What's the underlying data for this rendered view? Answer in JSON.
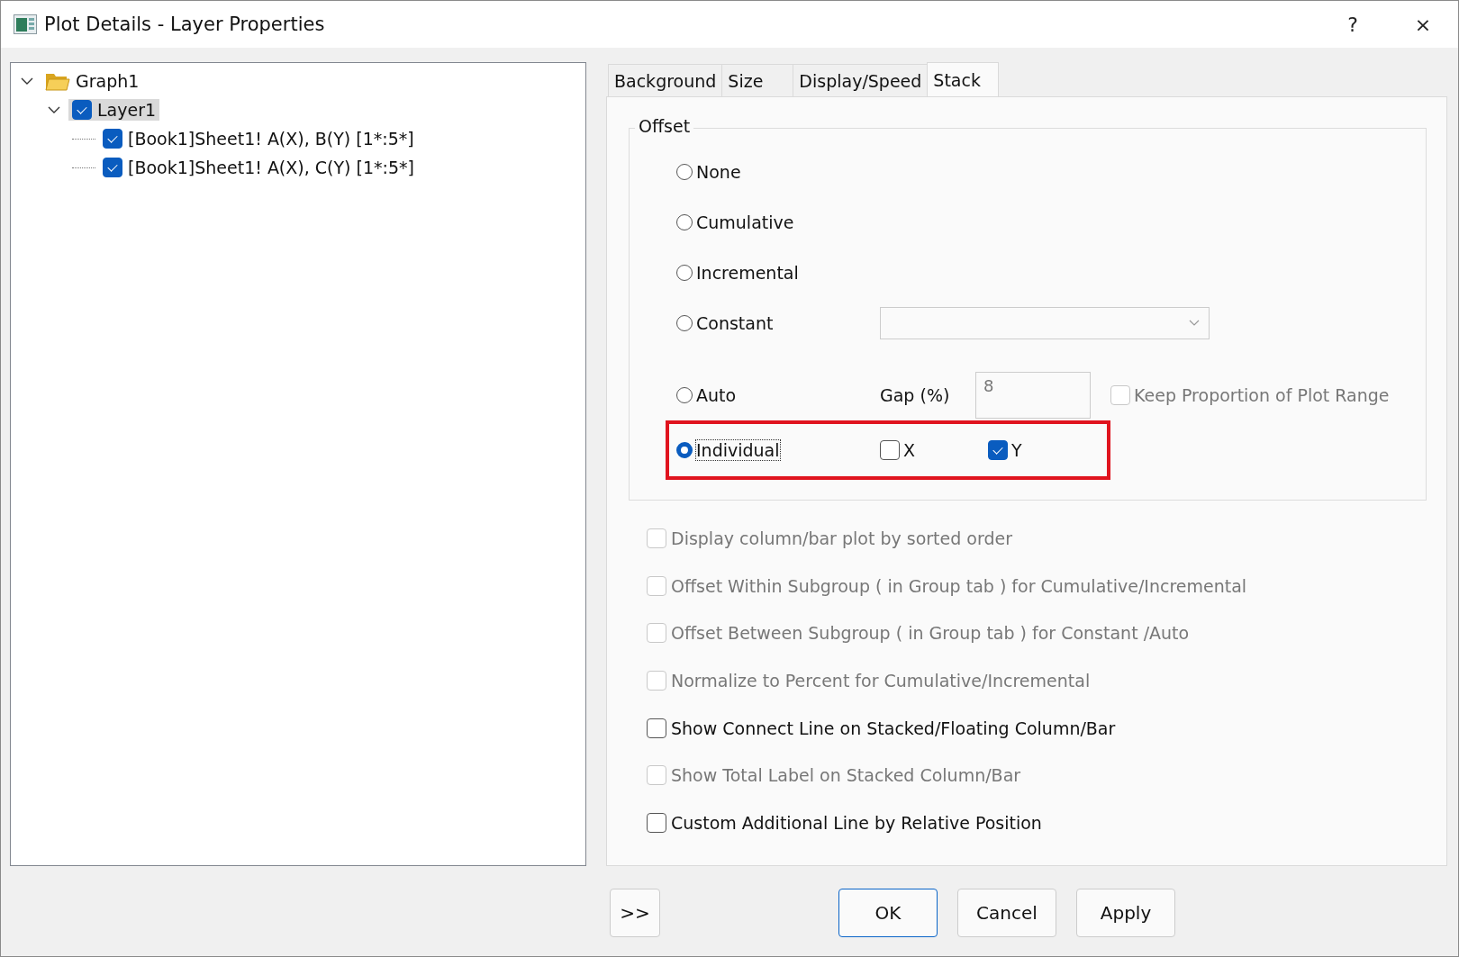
{
  "window": {
    "title": "Plot Details - Layer Properties",
    "buttons": [
      "?",
      "×"
    ]
  },
  "tree": [
    {
      "label": "Graph1",
      "kind": "folder",
      "expanded": true,
      "selected": false,
      "children": [
        {
          "label": "Layer1",
          "kind": "checkbox",
          "checked": true,
          "expanded": true,
          "selected": true,
          "children": [
            {
              "label": "[Book1]Sheet1! A(X), B(Y) [1*:5*]",
              "kind": "checkbox",
              "checked": true,
              "selected": false
            },
            {
              "label": "[Book1]Sheet1! A(X), C(Y) [1*:5*]",
              "kind": "checkbox",
              "checked": true,
              "selected": false
            }
          ]
        }
      ]
    }
  ],
  "tabs": [
    {
      "label": "Background",
      "selected": false
    },
    {
      "label": "Size",
      "selected": false
    },
    {
      "label": "Display/Speed",
      "selected": false
    },
    {
      "label": "Stack",
      "selected": true
    }
  ],
  "offset": {
    "title": "Offset",
    "options": [
      {
        "label": "None",
        "selected": false,
        "highlighted": false
      },
      {
        "label": "Cumulative",
        "selected": false,
        "highlighted": false
      },
      {
        "label": "Incremental",
        "selected": false,
        "highlighted": false
      },
      {
        "label": "Constant",
        "selected": false,
        "highlighted": false,
        "extras": [
          {
            "kind": "dropdown"
          }
        ]
      },
      {
        "label": "Auto",
        "selected": false,
        "highlighted": false,
        "extras": [
          {
            "kind": "label",
            "text": "Gap (%)"
          },
          {
            "kind": "field",
            "value": "8"
          },
          {
            "kind": "checkbox",
            "label": "Keep Proportion of Plot Range",
            "checked": false,
            "disabled": true
          }
        ]
      },
      {
        "label": "Individual",
        "selected": true,
        "highlighted": true,
        "extras": [
          {
            "kind": "checkbox",
            "label": "X",
            "checked": false,
            "disabled": false
          },
          {
            "kind": "checkbox",
            "label": "Y",
            "checked": true,
            "disabled": false
          }
        ]
      }
    ]
  },
  "options": [
    {
      "label": "Display column/bar plot by sorted order",
      "checked": false,
      "disabled": true
    },
    {
      "label": "Offset Within Subgroup ( in Group tab ) for Cumulative/Incremental",
      "checked": false,
      "disabled": true
    },
    {
      "label": "Offset Between Subgroup ( in Group tab ) for Constant /Auto",
      "checked": false,
      "disabled": true
    },
    {
      "label": "Normalize to Percent for Cumulative/Incremental",
      "checked": false,
      "disabled": true
    },
    {
      "label": "Show Connect Line on Stacked/Floating Column/Bar",
      "checked": false,
      "disabled": false
    },
    {
      "label": "Show Total Label on Stacked Column/Bar",
      "checked": false,
      "disabled": true
    },
    {
      "label": "Custom Additional Line by Relative Position",
      "checked": false,
      "disabled": false
    }
  ],
  "footer": {
    "more": ">>",
    "buttons": [
      {
        "label": "OK",
        "default": true
      },
      {
        "label": "Cancel",
        "default": false
      },
      {
        "label": "Apply",
        "default": false
      }
    ]
  }
}
